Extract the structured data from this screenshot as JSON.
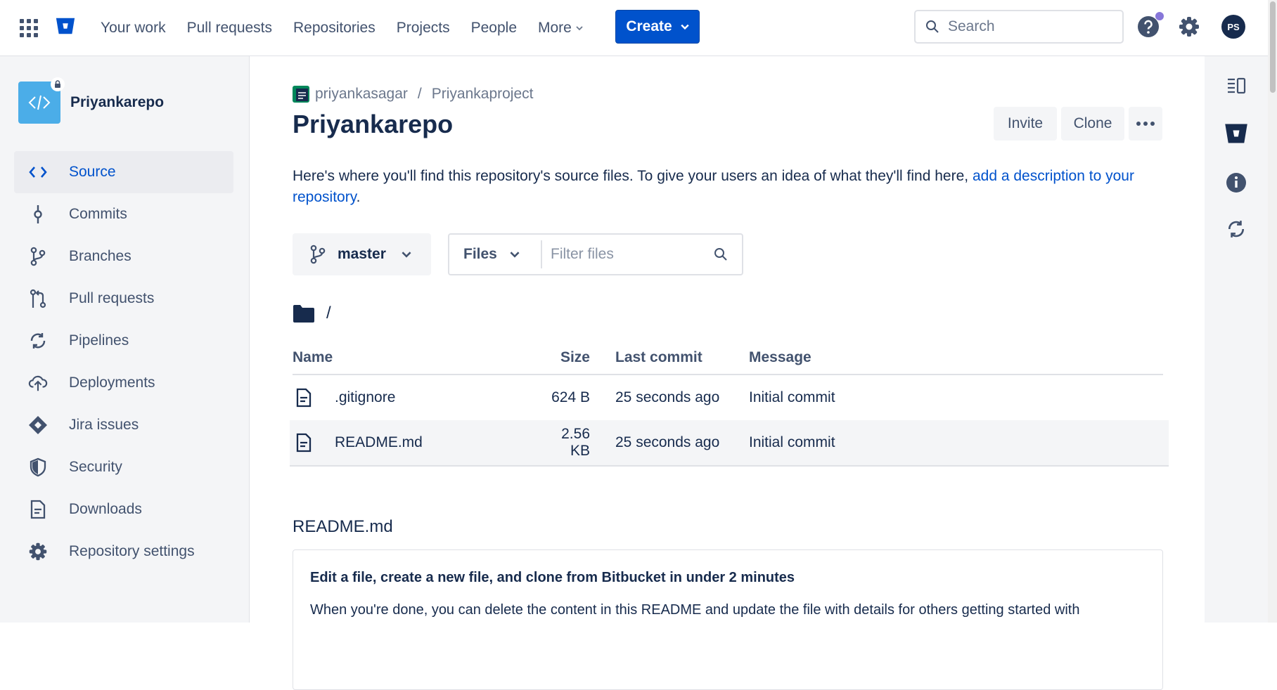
{
  "nav": {
    "items": [
      {
        "label": "Your work"
      },
      {
        "label": "Pull requests"
      },
      {
        "label": "Repositories"
      },
      {
        "label": "Projects"
      },
      {
        "label": "People"
      },
      {
        "label": "More"
      }
    ],
    "create_label": "Create",
    "search_placeholder": "Search",
    "avatar_initials": "PS"
  },
  "sidebar": {
    "repo_name": "Priyankarepo",
    "items": [
      {
        "label": "Source",
        "icon": "code-icon",
        "active": true
      },
      {
        "label": "Commits",
        "icon": "commit-icon"
      },
      {
        "label": "Branches",
        "icon": "branch-icon"
      },
      {
        "label": "Pull requests",
        "icon": "pull-request-icon"
      },
      {
        "label": "Pipelines",
        "icon": "pipelines-icon"
      },
      {
        "label": "Deployments",
        "icon": "cloud-upload-icon"
      },
      {
        "label": "Jira issues",
        "icon": "jira-icon"
      },
      {
        "label": "Security",
        "icon": "shield-icon"
      },
      {
        "label": "Downloads",
        "icon": "document-icon"
      },
      {
        "label": "Repository settings",
        "icon": "gear-icon"
      }
    ]
  },
  "main": {
    "breadcrumb": {
      "owner": "priyankasagar",
      "separator": "/",
      "project": "Priyankaproject"
    },
    "title": "Priyankarepo",
    "invite_label": "Invite",
    "clone_label": "Clone",
    "description_text": "Here's where you'll find this repository's source files. To give your users an idea of what they'll find here, ",
    "description_link": "add a description to your repository",
    "description_end": ".",
    "branch": "master",
    "files_dropdown": "Files",
    "filter_placeholder": "Filter files",
    "path": "/",
    "table": {
      "headers": {
        "name": "Name",
        "size": "Size",
        "commit": "Last commit",
        "message": "Message"
      },
      "rows": [
        {
          "name": ".gitignore",
          "size": "624 B",
          "commit": "25 seconds ago",
          "message": "Initial commit"
        },
        {
          "name": "README.md",
          "size": "2.56 KB",
          "commit": "25 seconds ago",
          "message": "Initial commit"
        }
      ]
    },
    "readme": {
      "title": "README.md",
      "heading": "Edit a file, create a new file, and clone from Bitbucket in under 2 minutes",
      "paragraph": "When you're done, you can delete the content in this README and update the file with details for others getting started with"
    }
  },
  "colors": {
    "accent": "#0052cc",
    "text": "#172b4d",
    "muted": "#42526e",
    "sidebar_bg": "#f4f5f7"
  }
}
